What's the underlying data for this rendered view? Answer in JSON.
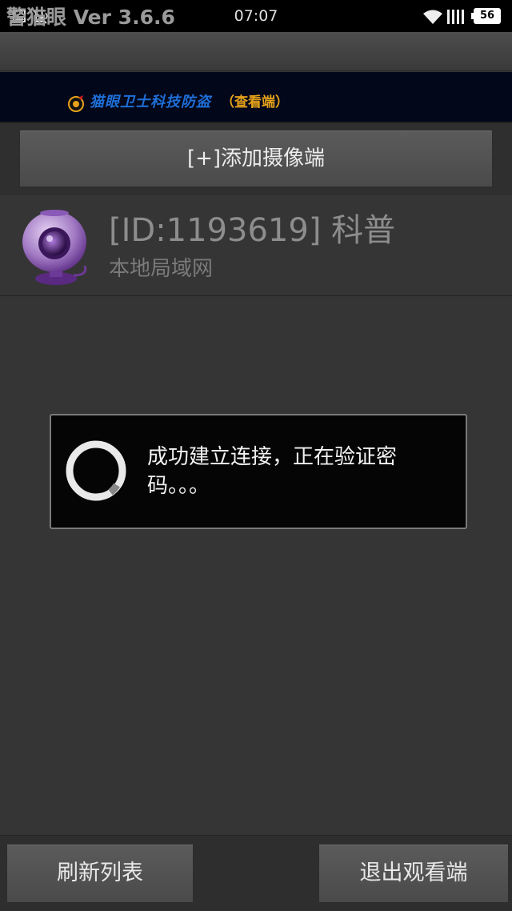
{
  "status_bar": {
    "time": "07:07",
    "battery": "56",
    "icons": [
      "image-icon",
      "vibrate-icon",
      "wifi-icon",
      "signal-icon",
      "battery-icon"
    ]
  },
  "app": {
    "title": "警猫眼 Ver 3.6.6"
  },
  "banner": {
    "brand": "猫眼卫士科技防盗",
    "subtitle": "（查看端）"
  },
  "toolbar": {
    "add_camera_label": "[+]添加摄像端"
  },
  "devices": [
    {
      "title": "[ID:1193619] 科普",
      "subtitle": "本地局域网",
      "icon": "webcam-icon"
    }
  ],
  "dialog": {
    "message": "成功建立连接，正在验证密码。。。"
  },
  "bottom_bar": {
    "refresh_label": "刷新列表",
    "exit_label": "退出观看端"
  },
  "colors": {
    "background": "#353535",
    "dialog_bg": "#050505",
    "banner_bg": "#03071a",
    "banner_brand": "#1f6fd8",
    "banner_sub": "#e6a21a",
    "webcam_purple": "#7a3aa8"
  }
}
